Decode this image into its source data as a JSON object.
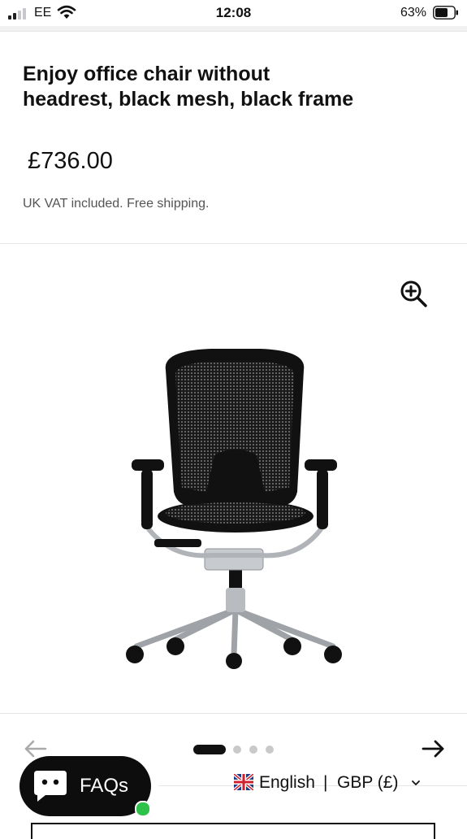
{
  "status_bar": {
    "carrier": "EE",
    "time": "12:08",
    "battery_percent": "63%",
    "signal_bars": 4,
    "signal_bars_active": 2,
    "battery_level": 0.63,
    "icons": [
      "signal-icon",
      "wifi-icon",
      "battery-icon"
    ]
  },
  "product": {
    "title": "Enjoy office chair without headrest, black mesh, black frame",
    "price": "£736.00",
    "vat_note": "UK VAT included. Free shipping."
  },
  "gallery": {
    "zoom_icon": "zoom-in-icon",
    "image": "office-chair",
    "prev_icon": "arrow-left-icon",
    "next_icon": "arrow-right-icon",
    "slide_count": 4,
    "active_slide": 1
  },
  "faq": {
    "label": "FAQs",
    "icon": "chat-bubble-icon",
    "status": "online",
    "status_color": "#2ec24a"
  },
  "locale": {
    "flag_icon": "uk-flag-icon",
    "language": "English",
    "separator": "|",
    "currency": "GBP (£)",
    "chevron_icon": "chevron-down-icon"
  },
  "colors": {
    "text": "#111111",
    "muted": "#555555",
    "faq_bg": "#0d0d0d",
    "dot_inactive": "#c9c9c9"
  }
}
